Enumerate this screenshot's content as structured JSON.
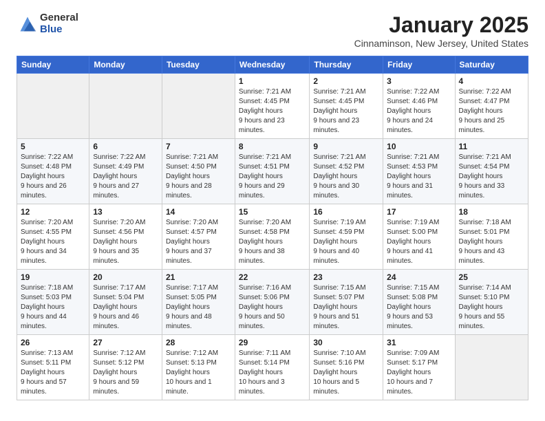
{
  "logo": {
    "general": "General",
    "blue": "Blue"
  },
  "title": "January 2025",
  "location": "Cinnaminson, New Jersey, United States",
  "days_header": [
    "Sunday",
    "Monday",
    "Tuesday",
    "Wednesday",
    "Thursday",
    "Friday",
    "Saturday"
  ],
  "weeks": [
    [
      {
        "day": "",
        "empty": true
      },
      {
        "day": "",
        "empty": true
      },
      {
        "day": "",
        "empty": true
      },
      {
        "day": "1",
        "sunrise": "7:21 AM",
        "sunset": "4:45 PM",
        "daylight": "9 hours and 23 minutes."
      },
      {
        "day": "2",
        "sunrise": "7:21 AM",
        "sunset": "4:45 PM",
        "daylight": "9 hours and 23 minutes."
      },
      {
        "day": "3",
        "sunrise": "7:22 AM",
        "sunset": "4:46 PM",
        "daylight": "9 hours and 24 minutes."
      },
      {
        "day": "4",
        "sunrise": "7:22 AM",
        "sunset": "4:47 PM",
        "daylight": "9 hours and 25 minutes."
      }
    ],
    [
      {
        "day": "5",
        "sunrise": "7:22 AM",
        "sunset": "4:48 PM",
        "daylight": "9 hours and 26 minutes."
      },
      {
        "day": "6",
        "sunrise": "7:22 AM",
        "sunset": "4:49 PM",
        "daylight": "9 hours and 27 minutes."
      },
      {
        "day": "7",
        "sunrise": "7:21 AM",
        "sunset": "4:50 PM",
        "daylight": "9 hours and 28 minutes."
      },
      {
        "day": "8",
        "sunrise": "7:21 AM",
        "sunset": "4:51 PM",
        "daylight": "9 hours and 29 minutes."
      },
      {
        "day": "9",
        "sunrise": "7:21 AM",
        "sunset": "4:52 PM",
        "daylight": "9 hours and 30 minutes."
      },
      {
        "day": "10",
        "sunrise": "7:21 AM",
        "sunset": "4:53 PM",
        "daylight": "9 hours and 31 minutes."
      },
      {
        "day": "11",
        "sunrise": "7:21 AM",
        "sunset": "4:54 PM",
        "daylight": "9 hours and 33 minutes."
      }
    ],
    [
      {
        "day": "12",
        "sunrise": "7:20 AM",
        "sunset": "4:55 PM",
        "daylight": "9 hours and 34 minutes."
      },
      {
        "day": "13",
        "sunrise": "7:20 AM",
        "sunset": "4:56 PM",
        "daylight": "9 hours and 35 minutes."
      },
      {
        "day": "14",
        "sunrise": "7:20 AM",
        "sunset": "4:57 PM",
        "daylight": "9 hours and 37 minutes."
      },
      {
        "day": "15",
        "sunrise": "7:20 AM",
        "sunset": "4:58 PM",
        "daylight": "9 hours and 38 minutes."
      },
      {
        "day": "16",
        "sunrise": "7:19 AM",
        "sunset": "4:59 PM",
        "daylight": "9 hours and 40 minutes."
      },
      {
        "day": "17",
        "sunrise": "7:19 AM",
        "sunset": "5:00 PM",
        "daylight": "9 hours and 41 minutes."
      },
      {
        "day": "18",
        "sunrise": "7:18 AM",
        "sunset": "5:01 PM",
        "daylight": "9 hours and 43 minutes."
      }
    ],
    [
      {
        "day": "19",
        "sunrise": "7:18 AM",
        "sunset": "5:03 PM",
        "daylight": "9 hours and 44 minutes."
      },
      {
        "day": "20",
        "sunrise": "7:17 AM",
        "sunset": "5:04 PM",
        "daylight": "9 hours and 46 minutes."
      },
      {
        "day": "21",
        "sunrise": "7:17 AM",
        "sunset": "5:05 PM",
        "daylight": "9 hours and 48 minutes."
      },
      {
        "day": "22",
        "sunrise": "7:16 AM",
        "sunset": "5:06 PM",
        "daylight": "9 hours and 50 minutes."
      },
      {
        "day": "23",
        "sunrise": "7:15 AM",
        "sunset": "5:07 PM",
        "daylight": "9 hours and 51 minutes."
      },
      {
        "day": "24",
        "sunrise": "7:15 AM",
        "sunset": "5:08 PM",
        "daylight": "9 hours and 53 minutes."
      },
      {
        "day": "25",
        "sunrise": "7:14 AM",
        "sunset": "5:10 PM",
        "daylight": "9 hours and 55 minutes."
      }
    ],
    [
      {
        "day": "26",
        "sunrise": "7:13 AM",
        "sunset": "5:11 PM",
        "daylight": "9 hours and 57 minutes."
      },
      {
        "day": "27",
        "sunrise": "7:12 AM",
        "sunset": "5:12 PM",
        "daylight": "9 hours and 59 minutes."
      },
      {
        "day": "28",
        "sunrise": "7:12 AM",
        "sunset": "5:13 PM",
        "daylight": "10 hours and 1 minute."
      },
      {
        "day": "29",
        "sunrise": "7:11 AM",
        "sunset": "5:14 PM",
        "daylight": "10 hours and 3 minutes."
      },
      {
        "day": "30",
        "sunrise": "7:10 AM",
        "sunset": "5:16 PM",
        "daylight": "10 hours and 5 minutes."
      },
      {
        "day": "31",
        "sunrise": "7:09 AM",
        "sunset": "5:17 PM",
        "daylight": "10 hours and 7 minutes."
      },
      {
        "day": "",
        "empty": true
      }
    ]
  ],
  "labels": {
    "sunrise": "Sunrise:",
    "sunset": "Sunset:",
    "daylight": "Daylight hours"
  }
}
